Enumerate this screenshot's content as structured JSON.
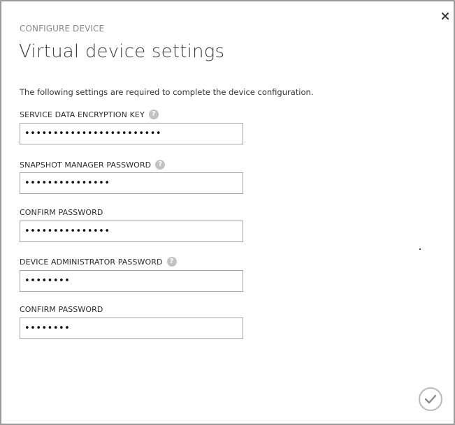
{
  "dialog": {
    "eyebrow": "CONFIGURE DEVICE",
    "title": "Virtual device settings",
    "intro": "The following settings are required to complete the device configuration."
  },
  "fields": [
    {
      "label": "SERVICE DATA ENCRYPTION KEY",
      "has_help": true,
      "value": "••••••••••••••••••••••••"
    },
    {
      "label": "SNAPSHOT MANAGER PASSWORD",
      "has_help": true,
      "value": "•••••••••••••••"
    },
    {
      "label": "CONFIRM PASSWORD",
      "has_help": false,
      "value": "•••••••••••••••"
    },
    {
      "label": "DEVICE ADMINISTRATOR PASSWORD",
      "has_help": true,
      "value": "••••••••"
    },
    {
      "label": "CONFIRM PASSWORD",
      "has_help": false,
      "value": "••••••••"
    }
  ],
  "icons": {
    "close": "close-icon",
    "help": "help-icon",
    "confirm": "checkmark-icon",
    "help_glyph": "?"
  },
  "colors": {
    "border": "#9a9a9a",
    "muted_text": "#8a8a8a",
    "help_icon": "#c2c2c2",
    "confirm_ring": "#b8b8b8"
  }
}
